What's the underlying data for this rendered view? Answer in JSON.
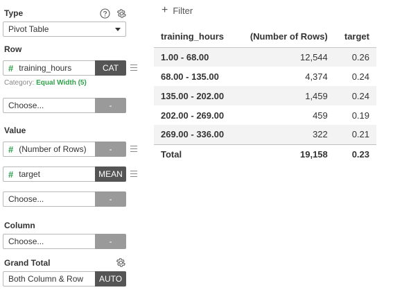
{
  "panel": {
    "type_label": "Type",
    "chart_type": "Pivot Table",
    "row_label": "Row",
    "row_field": {
      "name": "training_hours",
      "tag": "CAT"
    },
    "category_label": "Category:",
    "category_value": "Equal Width (5)",
    "row_choose": {
      "placeholder": "Choose...",
      "tag": "-"
    },
    "value_label": "Value",
    "value_fields": [
      {
        "name": "(Number of Rows)",
        "tag": "-"
      },
      {
        "name": "target",
        "tag": "MEAN"
      }
    ],
    "value_choose": {
      "placeholder": "Choose...",
      "tag": "-"
    },
    "column_label": "Column",
    "column_choose": {
      "placeholder": "Choose...",
      "tag": "-"
    },
    "grand_total_label": "Grand Total",
    "grand_total_value": "Both Column & Row",
    "grand_total_tag": "AUTO"
  },
  "toolbar": {
    "filter_label": "Filter"
  },
  "table": {
    "headers": [
      "training_hours",
      "(Number of Rows)",
      "target"
    ],
    "rows": [
      [
        "1.00 - 68.00",
        "12,544",
        "0.26"
      ],
      [
        "68.00 - 135.00",
        "4,374",
        "0.24"
      ],
      [
        "135.00 - 202.00",
        "1,459",
        "0.24"
      ],
      [
        "202.00 - 269.00",
        "459",
        "0.19"
      ],
      [
        "269.00 - 336.00",
        "322",
        "0.21"
      ]
    ],
    "total": [
      "Total",
      "19,158",
      "0.23"
    ]
  },
  "icons": {
    "help": "help-circle-icon",
    "settings": "gear-icon",
    "grand_total_settings": "gear-icon",
    "filter": "plus-icon",
    "drag": "drag-handle-icon"
  },
  "colors": {
    "accent_green": "#2fa14a",
    "tag_dark": "#555555",
    "tag_gray": "#9a9a9a"
  }
}
